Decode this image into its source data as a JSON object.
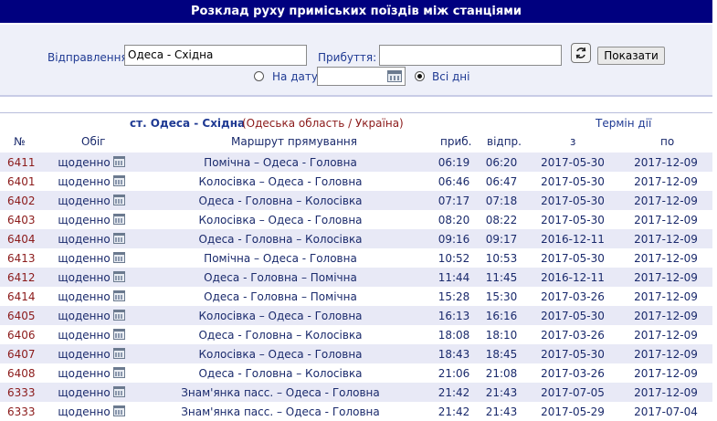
{
  "title": "Розклад руху приміських поїздів між станціями",
  "search": {
    "departure_label": "Відправлення:",
    "departure_value": "Одеса - Східна",
    "arrival_label": "Прибуття:",
    "arrival_value": "",
    "show_button": "Показати",
    "on_date_label": "На дату",
    "date_value": "",
    "all_days_label": "Всі дні",
    "selected_mode": "all_days"
  },
  "header": {
    "station": "ст. Одеса - Східна",
    "region": "(Одеська область / Україна)",
    "validity": "Термін дії",
    "col_num": "№",
    "col_circulation": "Обіг",
    "col_route": "Маршрут прямування",
    "col_arr": "приб.",
    "col_dep": "відпр.",
    "col_from": "з",
    "col_to": "по"
  },
  "trains": [
    {
      "num": "6411",
      "days": "щоденно",
      "route": "Помічна – Одеса - Головна",
      "arr": "06:19",
      "dep": "06:20",
      "from": "2017-05-30",
      "to": "2017-12-09"
    },
    {
      "num": "6401",
      "days": "щоденно",
      "route": "Колосівка – Одеса - Головна",
      "arr": "06:46",
      "dep": "06:47",
      "from": "2017-05-30",
      "to": "2017-12-09"
    },
    {
      "num": "6402",
      "days": "щоденно",
      "route": "Одеса - Головна – Колосівка",
      "arr": "07:17",
      "dep": "07:18",
      "from": "2017-05-30",
      "to": "2017-12-09"
    },
    {
      "num": "6403",
      "days": "щоденно",
      "route": "Колосівка – Одеса - Головна",
      "arr": "08:20",
      "dep": "08:22",
      "from": "2017-05-30",
      "to": "2017-12-09"
    },
    {
      "num": "6404",
      "days": "щоденно",
      "route": "Одеса - Головна – Колосівка",
      "arr": "09:16",
      "dep": "09:17",
      "from": "2016-12-11",
      "to": "2017-12-09"
    },
    {
      "num": "6413",
      "days": "щоденно",
      "route": "Помічна – Одеса - Головна",
      "arr": "10:52",
      "dep": "10:53",
      "from": "2017-05-30",
      "to": "2017-12-09"
    },
    {
      "num": "6412",
      "days": "щоденно",
      "route": "Одеса - Головна – Помічна",
      "arr": "11:44",
      "dep": "11:45",
      "from": "2016-12-11",
      "to": "2017-12-09"
    },
    {
      "num": "6414",
      "days": "щоденно",
      "route": "Одеса - Головна – Помічна",
      "arr": "15:28",
      "dep": "15:30",
      "from": "2017-03-26",
      "to": "2017-12-09"
    },
    {
      "num": "6405",
      "days": "щоденно",
      "route": "Колосівка – Одеса - Головна",
      "arr": "16:13",
      "dep": "16:16",
      "from": "2017-05-30",
      "to": "2017-12-09"
    },
    {
      "num": "6406",
      "days": "щоденно",
      "route": "Одеса - Головна – Колосівка",
      "arr": "18:08",
      "dep": "18:10",
      "from": "2017-03-26",
      "to": "2017-12-09"
    },
    {
      "num": "6407",
      "days": "щоденно",
      "route": "Колосівка – Одеса - Головна",
      "arr": "18:43",
      "dep": "18:45",
      "from": "2017-05-30",
      "to": "2017-12-09"
    },
    {
      "num": "6408",
      "days": "щоденно",
      "route": "Одеса - Головна – Колосівка",
      "arr": "21:06",
      "dep": "21:08",
      "from": "2017-03-26",
      "to": "2017-12-09"
    },
    {
      "num": "6333",
      "days": "щоденно",
      "route": "Знам'янка пасс. – Одеса - Головна",
      "arr": "21:42",
      "dep": "21:43",
      "from": "2017-07-05",
      "to": "2017-12-09"
    },
    {
      "num": "6333",
      "days": "щоденно",
      "route": "Знам'янка пасс. – Одеса - Головна",
      "arr": "21:42",
      "dep": "21:43",
      "from": "2017-05-29",
      "to": "2017-07-04"
    }
  ],
  "colors": {
    "title_bg": "#00007f",
    "panel_bg": "#eef0f9",
    "row_alt": "#e8e9f6",
    "train_num": "#8b1a1a",
    "region": "#8b1a1a"
  },
  "icons": {
    "swap": "swap-arrows-icon",
    "calendar": "calendar-icon"
  }
}
